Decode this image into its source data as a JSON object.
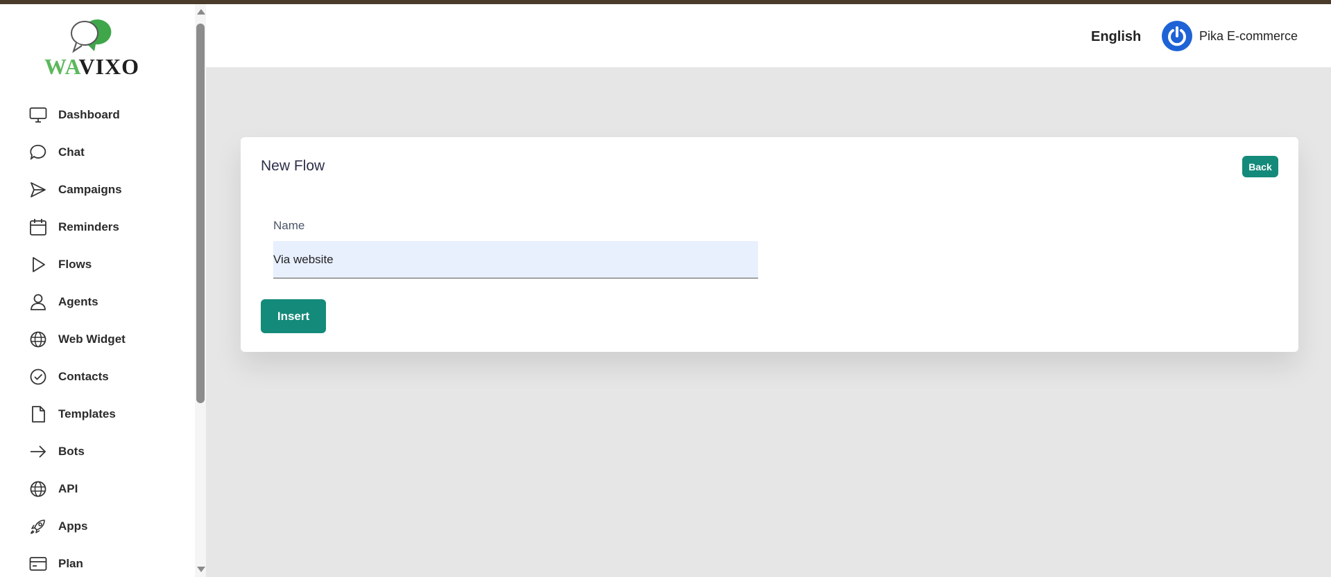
{
  "brand": {
    "logo_wa": "WA",
    "logo_vixo": "VIXO",
    "accent": "#148a7a",
    "logo_green": "#5cb85c"
  },
  "sidebar": {
    "items": [
      {
        "label": "Dashboard",
        "icon": "monitor-icon"
      },
      {
        "label": "Chat",
        "icon": "chat-bubble-icon"
      },
      {
        "label": "Campaigns",
        "icon": "send-icon"
      },
      {
        "label": "Reminders",
        "icon": "calendar-icon"
      },
      {
        "label": "Flows",
        "icon": "play-icon"
      },
      {
        "label": "Agents",
        "icon": "user-icon"
      },
      {
        "label": "Web Widget",
        "icon": "globe-icon"
      },
      {
        "label": "Contacts",
        "icon": "check-badge-icon"
      },
      {
        "label": "Templates",
        "icon": "document-icon"
      },
      {
        "label": "Bots",
        "icon": "arrow-right-icon"
      },
      {
        "label": "API",
        "icon": "globe-icon"
      },
      {
        "label": "Apps",
        "icon": "rocket-icon"
      },
      {
        "label": "Plan",
        "icon": "credit-card-icon"
      }
    ]
  },
  "header": {
    "language": "English",
    "user_name": "Pika E-commerce",
    "avatar_color": "#1e63d6"
  },
  "card": {
    "title": "New Flow",
    "back_label": "Back",
    "name_label": "Name",
    "name_value": "Via website",
    "insert_label": "Insert"
  }
}
